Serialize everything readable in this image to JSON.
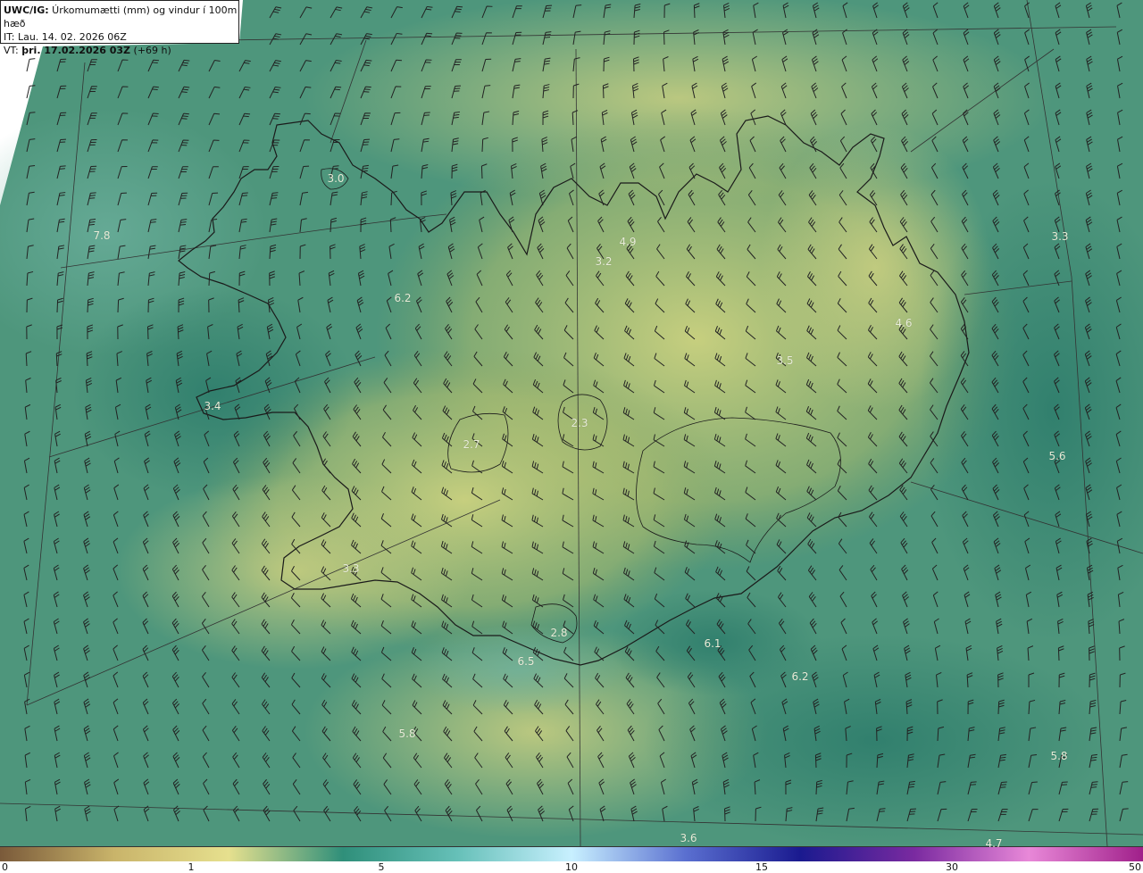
{
  "header": {
    "model_prefix": "UWC/IG:",
    "title_rest": " Úrkomumætti (mm) og vindur í 100m hæð",
    "it_line": "IT: Lau. 14. 02. 2026 06Z",
    "vt_prefix": "VT: ",
    "vt_bold": "þri. 17.02.2026 03Z",
    "vt_suffix": " (+69 h)"
  },
  "map_values": [
    {
      "text": "3.0"
    },
    {
      "text": "7.8"
    },
    {
      "text": "6.2"
    },
    {
      "text": "3.4"
    },
    {
      "text": "4.9"
    },
    {
      "text": "3.2"
    },
    {
      "text": "3.5"
    },
    {
      "text": "2.3"
    },
    {
      "text": "2.7"
    },
    {
      "text": "4.6"
    },
    {
      "text": "3.3"
    },
    {
      "text": "5.6"
    },
    {
      "text": "3.3"
    },
    {
      "text": "6.1"
    },
    {
      "text": "6.5"
    },
    {
      "text": "2.8"
    },
    {
      "text": "6.2"
    },
    {
      "text": "5.8"
    },
    {
      "text": "5.8"
    },
    {
      "text": "3.6"
    },
    {
      "text": "4.7"
    }
  ],
  "colorbar": {
    "ticks": [
      "0",
      "1",
      "5",
      "10",
      "15",
      "30",
      "50"
    ],
    "colors": [
      "#7a5a3a",
      "#c9b46a",
      "#e6e08e",
      "#2f8f7a",
      "#66c0b8",
      "#c8f0ff",
      "#5a6fd0",
      "#1a1a8f",
      "#7a2aa0",
      "#e888d8",
      "#a0208a"
    ]
  },
  "colors": {
    "sea": "#3b8a73",
    "land_light": "#c8cf7e",
    "coast": "#1a1a1a",
    "grid": "#333333",
    "barb": "#222222"
  }
}
